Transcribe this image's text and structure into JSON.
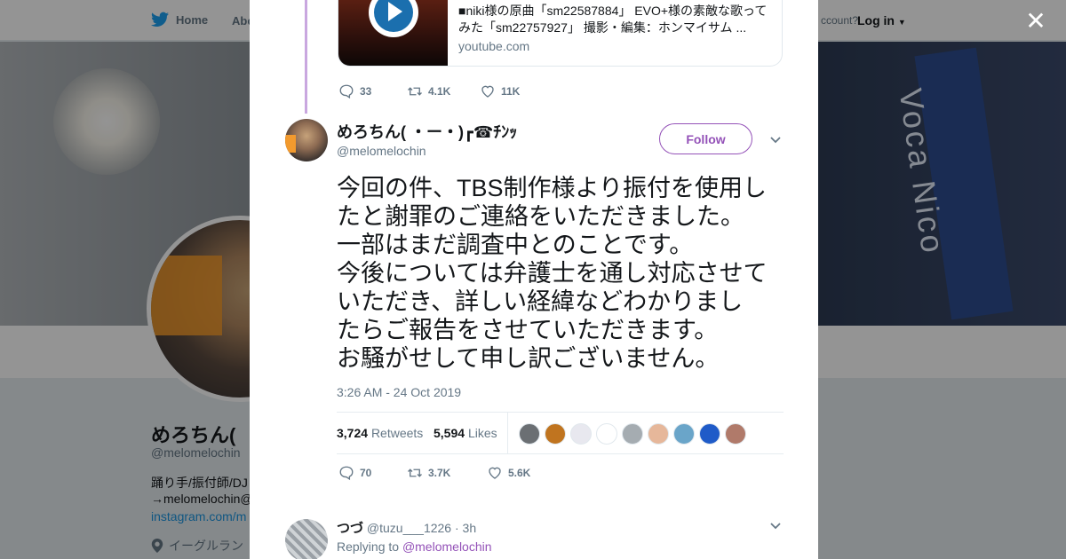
{
  "nav": {
    "home": "Home",
    "about": "Abo",
    "account_prompt": "ccount?",
    "login": "Log in"
  },
  "background_profile": {
    "name": "めろちん(",
    "handle": "@melomelochin",
    "bio_line1": "踊り手/振付師/DJ",
    "bio_line2": "→melomelochin@",
    "link": "instagram.com/m",
    "location": "イーグルラン",
    "cover_sign_text": "Voca Nico"
  },
  "quoted_card": {
    "text": "■niki様の原曲「sm22587884」 EVO+様の素敵な歌ってみた「sm22757927」 撮影・編集：ホンマイサム ...",
    "domain": "youtube.com"
  },
  "prev_actions": {
    "replies": "33",
    "retweets": "4.1K",
    "likes": "11K"
  },
  "tweet": {
    "name": "めろちん( ・ー・)┏☎ﾁﾝｯ",
    "handle": "@melomelochin",
    "follow_label": "Follow",
    "text": "今回の件、TBS制作様より振付を使用し\nたと謝罪のご連絡をいただきました。\n一部はまだ調査中とのことです。\n今後については弁護士を通し対応させて\nいただき、詳しい経緯などわかりまし\nたらご報告をさせていただきます。\nお騒がせして申し訳ございません。",
    "timestamp": "3:26 AM - 24 Oct 2019",
    "retweet_count": "3,724",
    "retweet_label": "Retweets",
    "like_count": "5,594",
    "like_label": "Likes",
    "replies": "70",
    "retweets": "3.7K",
    "likes": "5.6K"
  },
  "liker_colors": [
    "#6b6f73",
    "#c0741f",
    "#e8e8ef",
    "#ffffff",
    "#a5acb1",
    "#e6b79a",
    "#6aa5c9",
    "#1f5bc8",
    "#b07a6a"
  ],
  "reply": {
    "name": "つづ",
    "handle": "@tuzu___1226",
    "time": "3h",
    "replying_to_label": "Replying to",
    "replying_to_handle": "@melomelochin"
  },
  "colors": {
    "accent": "#9452b8",
    "twitter_blue": "#1da1f2",
    "muted": "#657786"
  }
}
